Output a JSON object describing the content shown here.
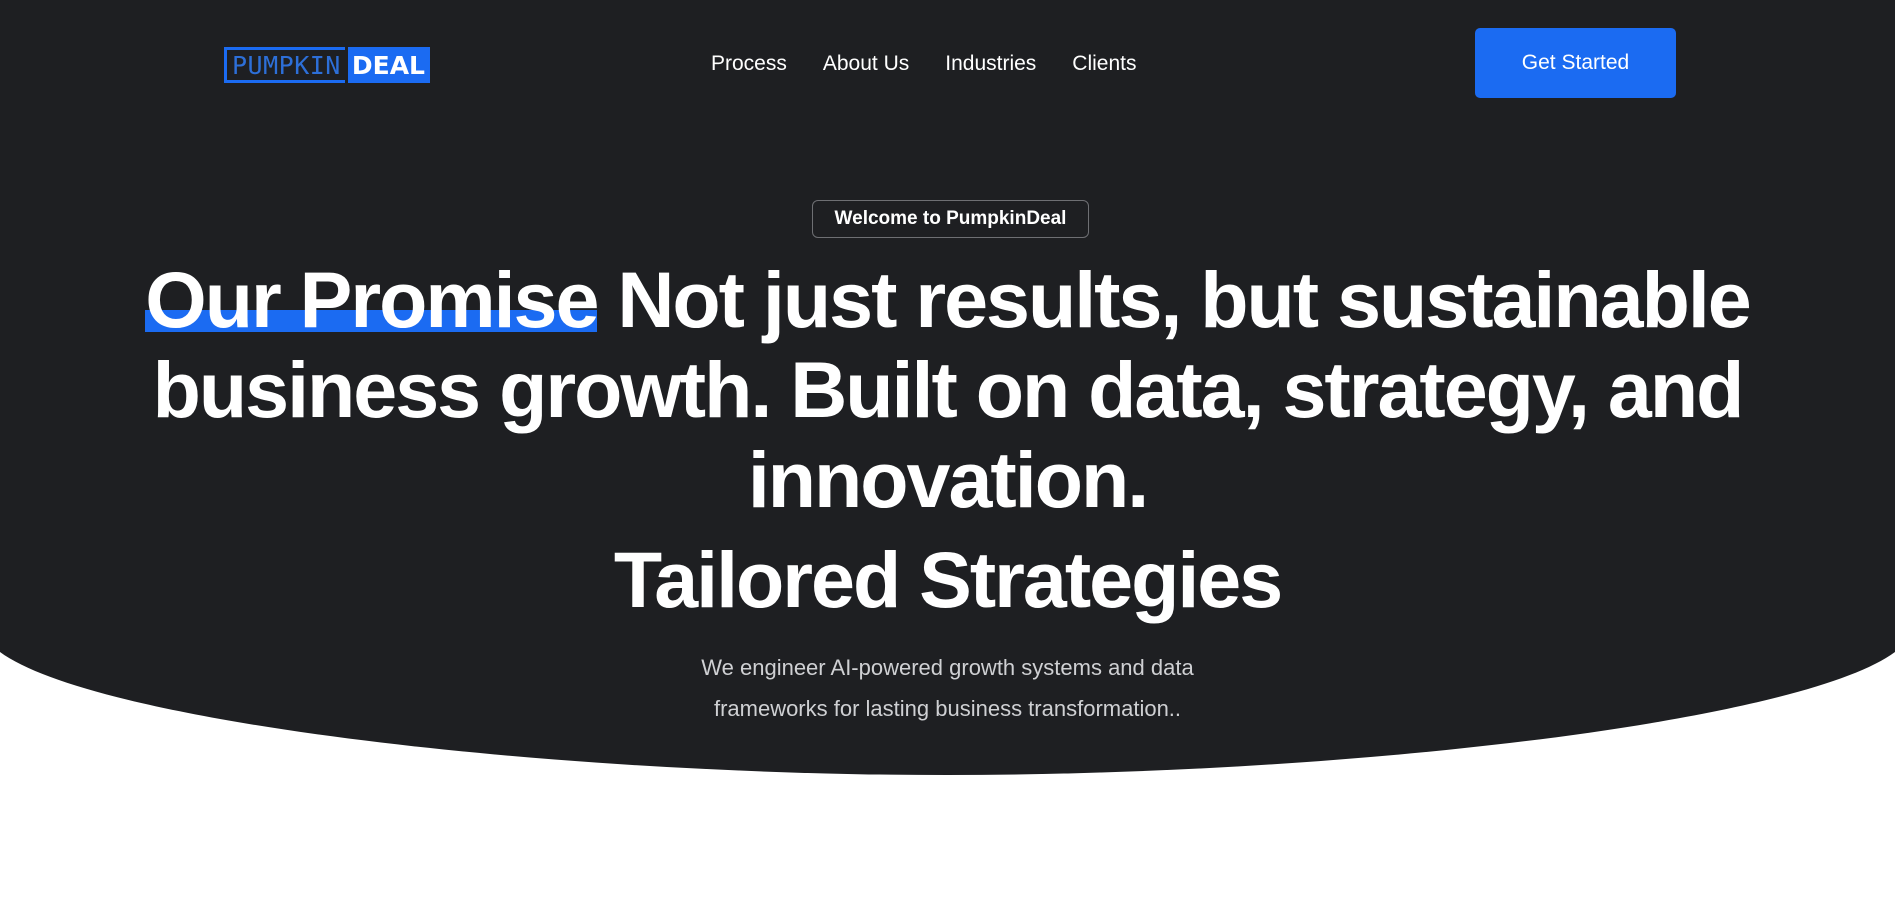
{
  "brand": {
    "logo_left": "PUMPKIN",
    "logo_right": "DEAL"
  },
  "nav": {
    "items": [
      "Process",
      "About Us",
      "Industries",
      "Clients"
    ]
  },
  "header": {
    "cta_label": "Get Started"
  },
  "hero": {
    "badge": "Welcome to PumpkinDeal",
    "headline_highlight": "Our Promise",
    "headline_rest": " Not just results, but sustainable business growth. Built on data, strategy, and innovation.",
    "rotating_word": "Tailored Strategies",
    "subtitle": "We engineer AI-powered growth systems and data frameworks for lasting business transformation.."
  },
  "colors": {
    "background_dark": "#1e1f22",
    "accent_blue": "#1b6bf2",
    "page_white": "#ffffff"
  }
}
